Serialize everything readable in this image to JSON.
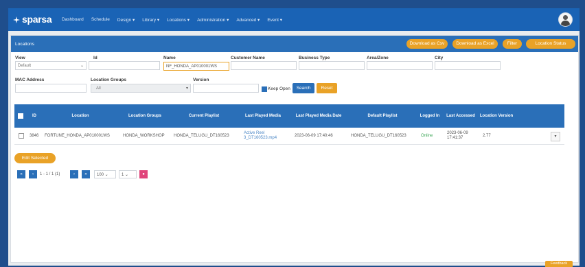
{
  "header": {
    "logo": "sparsa",
    "nav": [
      "Dashboard",
      "Schedule",
      "Design ▾",
      "Library ▾",
      "Locations ▾",
      "Administration ▾",
      "Advanced ▾",
      "Event ▾"
    ]
  },
  "panel": {
    "title": "Locations",
    "buttons": [
      "Download as Csv",
      "Download as Excel",
      "Filter",
      "Location Status"
    ]
  },
  "filters": {
    "view_label": "View",
    "view_value": "Default",
    "id_label": "Id",
    "id_value": "",
    "name_label": "Name",
    "name_value": "NF_HONDA_AP010001WS",
    "customer_label": "Customer Name",
    "customer_value": "",
    "business_label": "Business Type",
    "business_value": "",
    "area_label": "Area/Zone",
    "area_value": "",
    "city_label": "City",
    "city_value": "",
    "mac_label": "MAC Address",
    "mac_value": "",
    "groups_label": "Location Groups",
    "groups_value": "All",
    "version_label": "Version",
    "version_value": "",
    "keep_open": "Keep Open",
    "search": "Search",
    "reset": "Reset"
  },
  "table": {
    "headers": [
      "ID",
      "Location",
      "Location Groups",
      "Current Playlist",
      "Last Played Media",
      "Last Played Media Date",
      "Default Playlist",
      "Logged In",
      "Last Accessed",
      "Location Version"
    ],
    "rows": [
      {
        "id": "3846",
        "location": "FORTUNE_HONDA_AP010001WS",
        "groups": "HONDA_WORKSHOP",
        "current_playlist": "HONDA_TELUGU_DT160523",
        "last_media": "Active Reel 3_DT160523.mp4",
        "last_media_date": "2023-06-09 17:40:46",
        "default_playlist": "HONDA_TELUGU_DT160523",
        "logged_in": "Online",
        "last_accessed": "2023-06-09 17:41:37",
        "version": "2.77"
      }
    ]
  },
  "pagination": {
    "edit_selected": "Edit Selected",
    "range": "1 - 1 / 1 (1)",
    "page_size": "100",
    "page": "1"
  },
  "feedback": "Feedback",
  "colors": {
    "primary": "#2a6fb8",
    "accent": "#e9a227",
    "online": "#3aa655"
  }
}
